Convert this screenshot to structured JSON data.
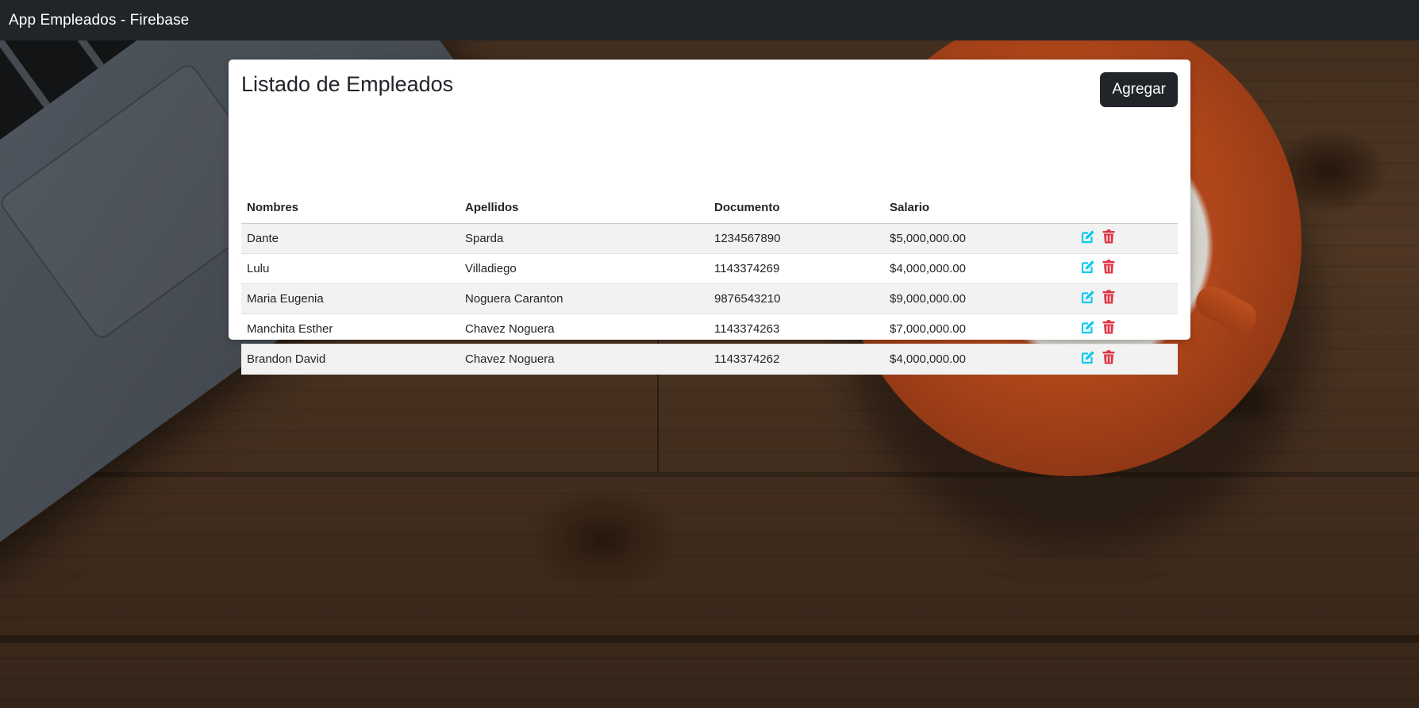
{
  "navbar": {
    "brand": "App Empleados - Firebase"
  },
  "card": {
    "title": "Listado de Empleados",
    "add_button": "Agregar"
  },
  "table": {
    "headers": [
      "Nombres",
      "Apellidos",
      "Documento",
      "Salario",
      ""
    ],
    "rows": [
      {
        "nombres": "Dante",
        "apellidos": "Sparda",
        "documento": "1234567890",
        "salario": "$5,000,000.00"
      },
      {
        "nombres": "Lulu",
        "apellidos": "Villadiego",
        "documento": "1143374269",
        "salario": "$4,000,000.00"
      },
      {
        "nombres": "Maria Eugenia",
        "apellidos": "Noguera Caranton",
        "documento": "9876543210",
        "salario": "$9,000,000.00"
      },
      {
        "nombres": "Manchita Esther",
        "apellidos": "Chavez Noguera",
        "documento": "1143374263",
        "salario": "$7,000,000.00"
      },
      {
        "nombres": "Brandon David",
        "apellidos": "Chavez Noguera",
        "documento": "1143374262",
        "salario": "$4,000,000.00"
      }
    ],
    "row_actions": [
      {
        "icon": "edit-icon",
        "color": "#0dcaf0"
      },
      {
        "icon": "trash-icon",
        "color": "#dc3545"
      }
    ]
  },
  "colors": {
    "navbar_bg": "#212529",
    "button_bg": "#212529",
    "edit": "#0dcaf0",
    "delete": "#dc3545"
  }
}
